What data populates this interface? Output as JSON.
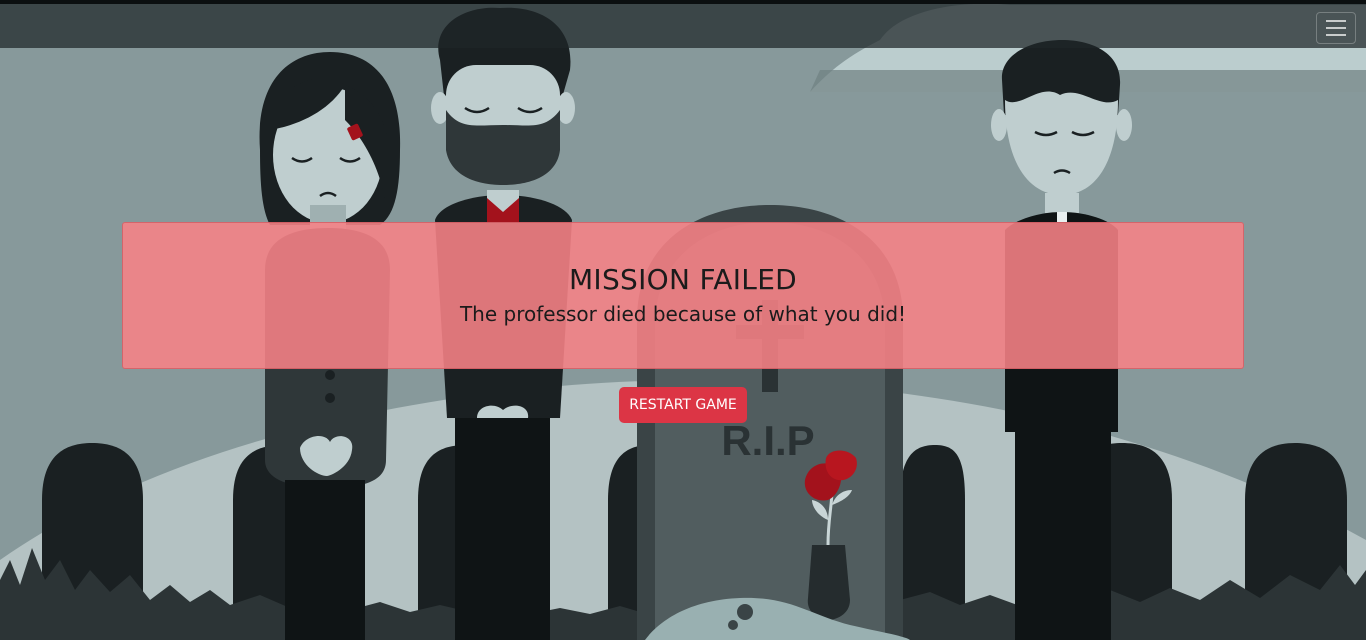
{
  "scene": {
    "tombstone_text": "R.I.P",
    "icons": [
      "menu-icon"
    ]
  },
  "alert": {
    "title": "MISSION FAILED",
    "message": "The professor died because of what you did!"
  },
  "restart_button": {
    "label": "RESTART GAME"
  },
  "colors": {
    "alert_bg": "#f88286",
    "button_bg": "#dc3545",
    "scene_bg": "#87999b",
    "accent_red": "#a3121c"
  }
}
